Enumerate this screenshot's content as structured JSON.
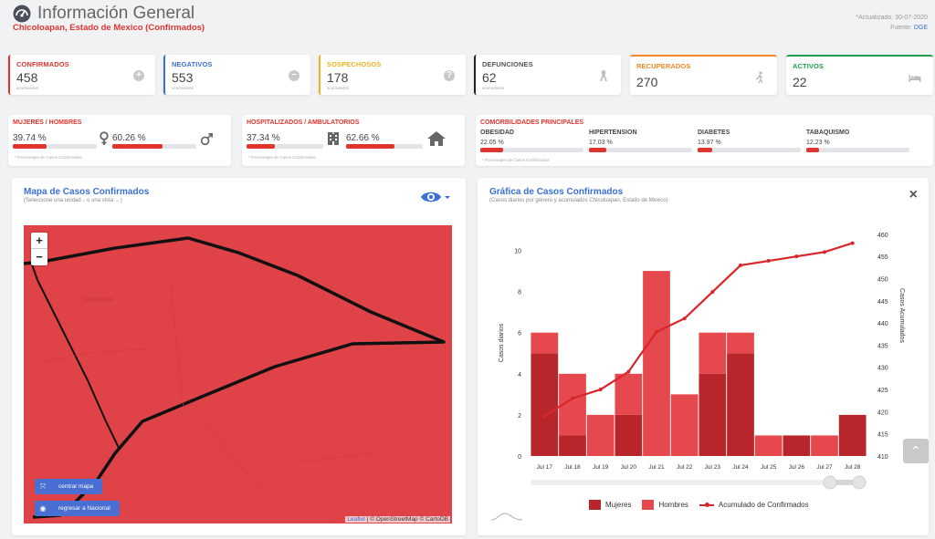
{
  "header": {
    "title": "Información General",
    "subtitle": "Chicoloapan, Estado de Mexico (Confirmados)",
    "updated": "*Actualizado: 30-07-2020",
    "source_label": "Fuente:",
    "source": "DGE"
  },
  "stats": [
    {
      "label": "CONFIRMADOS",
      "value": "458",
      "caption": "acumulados",
      "color": "#e0342f",
      "icon": "plus-circle-icon"
    },
    {
      "label": "NEGATIVOS",
      "value": "553",
      "caption": "acumulados",
      "color": "#3b6fd6",
      "icon": "minus-circle-icon"
    },
    {
      "label": "SOSPECHOSOS",
      "value": "178",
      "caption": "acumulados",
      "color": "#f0b320",
      "icon": "question-circle-icon"
    },
    {
      "label": "DEFUNCIONES",
      "value": "62",
      "caption": "acumulados",
      "color": "#222222",
      "icon": "ribbon-icon"
    },
    {
      "label": "RECUPERADOS",
      "value": "270",
      "color": "#f08a24",
      "icon": "walking-icon"
    },
    {
      "label": "ACTIVOS",
      "value": "22",
      "color": "#22a04b",
      "icon": "bed-icon"
    }
  ],
  "gender": {
    "label": "MUJERES / HOMBRES",
    "women_pct": "39.74 %",
    "men_pct": "60.26 %",
    "women_value": 0.3974,
    "men_value": 0.6026,
    "note": "* Porcentajes de Casos Confirmados"
  },
  "hospital": {
    "label": "HOSPITALIZADOS / AMBULATORIOS",
    "hosp_pct": "37.34 %",
    "amb_pct": "62.66 %",
    "hosp_value": 0.3734,
    "amb_value": 0.6266,
    "note": "* Porcentajes de Casos Confirmados"
  },
  "comorbidities": {
    "label": "COMORBILIDADES PRINCIPALES",
    "items": [
      {
        "name": "OBESIDAD",
        "pct": "22.05 %",
        "value": 0.2205
      },
      {
        "name": "HIPERTENSION",
        "pct": "17.03 %",
        "value": 0.1703
      },
      {
        "name": "DIABETES",
        "pct": "13.97 %",
        "value": 0.1397
      },
      {
        "name": "TABAQUISMO",
        "pct": "12.23 %",
        "value": 0.1223
      }
    ],
    "note": "* Porcentajes de Casos Confirmados"
  },
  "map": {
    "title": "Mapa de Casos Confirmados",
    "subtitle": "(Seleccione una unidad ↓ o una vista →)",
    "zoom_in": "+",
    "zoom_out": "−",
    "center_button": "centrar mapa",
    "national_button": "regresar a Nacional",
    "place_label": "Chicoloapan",
    "attribution_leaflet": "Leaflet",
    "attribution_rest": " | © OpenStreetMap © CartoDB"
  },
  "chart_panel": {
    "title": "Gráfica de Casos Confirmados",
    "subtitle": "(Casos diarios por género y acumulados Chicoloapan, Estado de Mexico)",
    "close": "×"
  },
  "chart_data": {
    "type": "bar",
    "categories": [
      "Jul 17",
      "Jul 18",
      "Jul 19",
      "Jul 20",
      "Jul 21",
      "Jul 22",
      "Jul 23",
      "Jul 24",
      "Jul 25",
      "Jul 26",
      "Jul 27",
      "Jul 28"
    ],
    "series": [
      {
        "name": "Mujeres",
        "type": "bar",
        "color": "#b8262b",
        "values": [
          5,
          1,
          0,
          2,
          0,
          0,
          4,
          5,
          0,
          1,
          0,
          2
        ]
      },
      {
        "name": "Hombres",
        "type": "bar",
        "color": "#e5484d",
        "values": [
          1,
          3,
          2,
          2,
          9,
          3,
          2,
          1,
          1,
          0,
          1,
          0
        ]
      },
      {
        "name": "Acumulado de Confirmados",
        "type": "line",
        "axis": "right",
        "color": "#d8262b",
        "values": [
          419,
          423,
          425,
          429,
          438,
          441,
          447,
          453,
          454,
          455,
          456,
          458
        ]
      }
    ],
    "ylabel": "Casos diarios",
    "y2label": "Casos Acumulados",
    "ylim": [
      0,
      11
    ],
    "y2lim": [
      410,
      461
    ],
    "yticks": [
      0,
      2,
      4,
      6,
      8,
      10
    ],
    "y2ticks": [
      410,
      415,
      420,
      425,
      430,
      435,
      440,
      445,
      450,
      455,
      460
    ],
    "legend_position": "bottom"
  }
}
